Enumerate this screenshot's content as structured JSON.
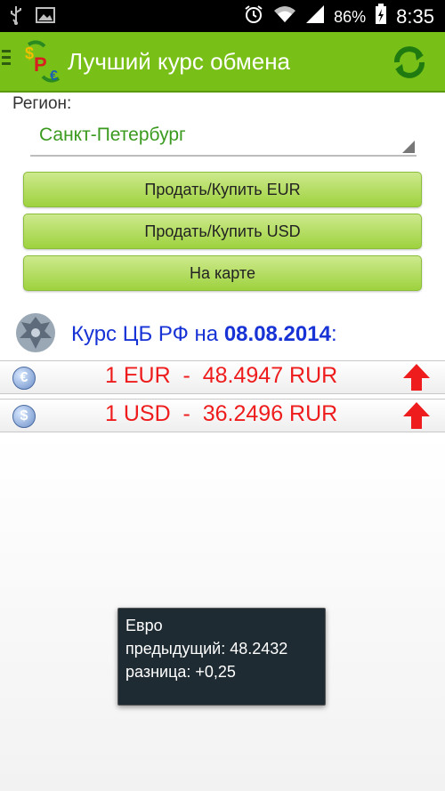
{
  "statusbar": {
    "battery": "86%",
    "time": "8:35",
    "icons": [
      "usb-icon",
      "image-icon",
      "alarm-icon",
      "wifi-icon",
      "signal-icon",
      "battery-icon"
    ]
  },
  "actionbar": {
    "title": "Лучший курс обмена",
    "color": "#78c018"
  },
  "region": {
    "label": "Регион:",
    "selected": "Санкт-Петербург"
  },
  "buttons": {
    "eur": "Продать/Купить EUR",
    "usd": "Продать/Купить USD",
    "map": "На карте"
  },
  "cb": {
    "prefix": "Курс ЦБ РФ на ",
    "date": "08.08.2014",
    "suffix": ":"
  },
  "rates": [
    {
      "icon": "euro-coin-icon",
      "symbol": "€",
      "text": "1 EUR  -  48.4947 RUR",
      "trend": "up"
    },
    {
      "icon": "dollar-coin-icon",
      "symbol": "$",
      "text": "1 USD  -  36.2496 RUR",
      "trend": "up"
    }
  ],
  "toast": {
    "line1": "Евро",
    "line2": "предыдущий: 48.2432",
    "line3": "разница: +0,25"
  }
}
